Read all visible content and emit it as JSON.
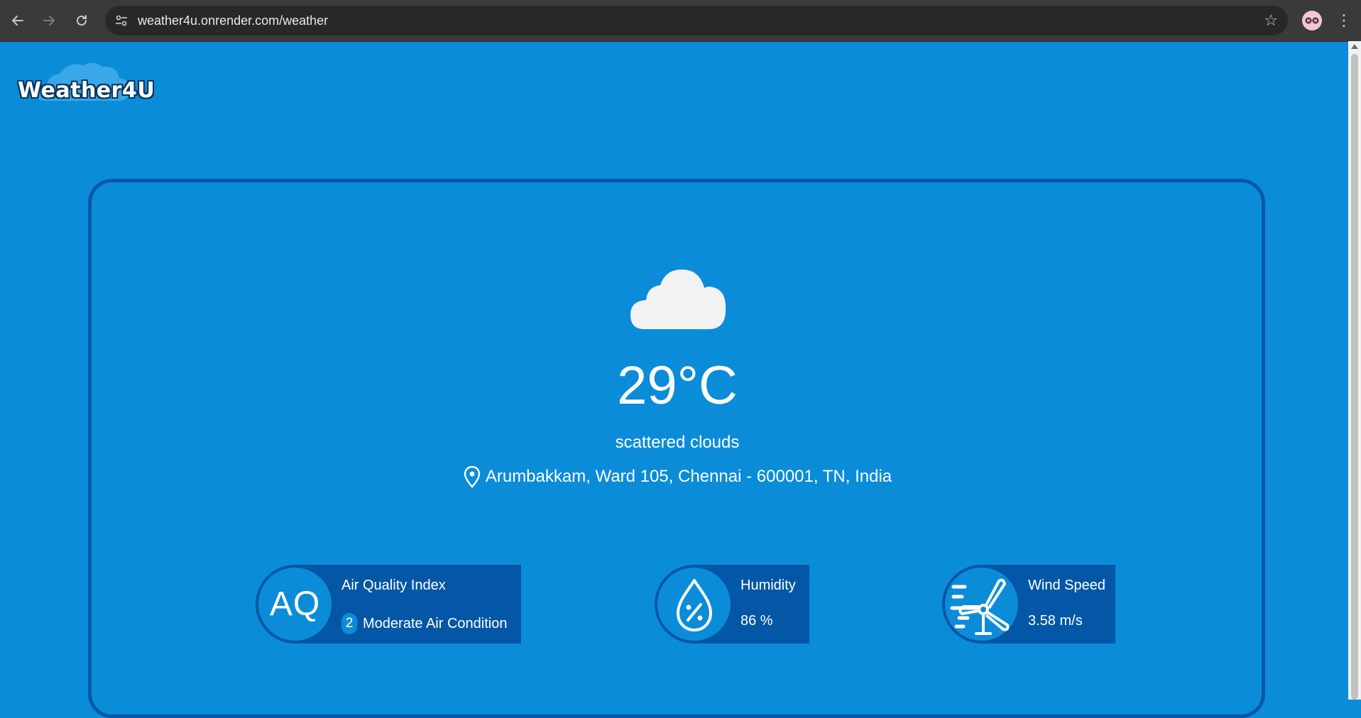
{
  "browser": {
    "url": "weather4u.onrender.com/weather"
  },
  "app": {
    "logo_text": "Weather4U"
  },
  "weather": {
    "temperature": "29°C",
    "description": "scattered clouds",
    "location": "Arumbakkam, Ward 105, Chennai - 600001, TN, India"
  },
  "stats": {
    "aqi": {
      "icon_text": "AQ",
      "label": "Air Quality Index",
      "index": "2",
      "value": "Moderate Air Condition"
    },
    "humidity": {
      "label": "Humidity",
      "value": "86 %"
    },
    "wind": {
      "label": "Wind Speed",
      "value": "3.58 m/s"
    }
  },
  "colors": {
    "background": "#0B8CD9",
    "accent_dark": "#0457A6",
    "text": "#FFFFFF"
  },
  "icons": [
    "back-arrow-icon",
    "forward-arrow-icon",
    "reload-icon",
    "site-settings-icon",
    "bookmark-star-icon",
    "profile-avatar-icon",
    "more-menu-icon",
    "cloud-icon",
    "location-pin-icon",
    "humidity-drop-icon",
    "wind-turbine-icon"
  ]
}
